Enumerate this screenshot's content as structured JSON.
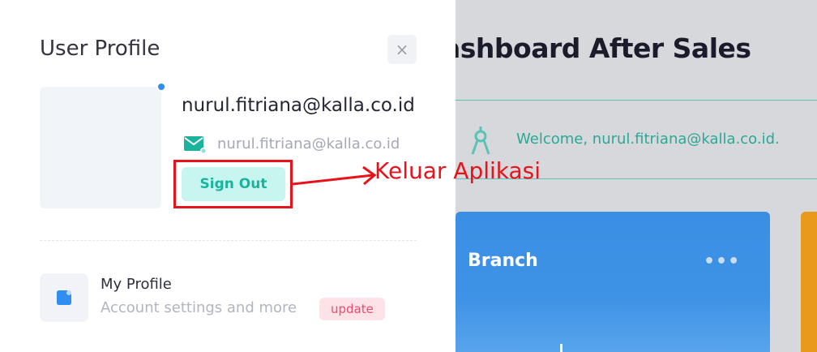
{
  "dashboard": {
    "title": "ashboard After Sales",
    "welcome_text": "Welcome, nurul.fitriana@kalla.co.id.",
    "branch_card": {
      "title": "Branch",
      "more_label": "•••"
    }
  },
  "profile_panel": {
    "title": "User Profile",
    "close_label": "×",
    "user": {
      "email": "nurul.fitriana@kalla.co.id",
      "email_secondary": "nurul.fitriana@kalla.co.id"
    },
    "sign_out_label": "Sign Out",
    "menu": [
      {
        "title": "My Profile",
        "subtitle": "Account settings and more",
        "badge": "update"
      }
    ]
  },
  "annotation": {
    "text": "Keluar Aplikasi",
    "color": "#e8121b"
  },
  "colors": {
    "accent_teal": "#1bb39b",
    "accent_blue": "#2f8ff0",
    "badge_red": "#f14a6c"
  },
  "icons": [
    "close-icon",
    "mail-icon",
    "compass-icon",
    "profile-icon",
    "more-icon"
  ]
}
